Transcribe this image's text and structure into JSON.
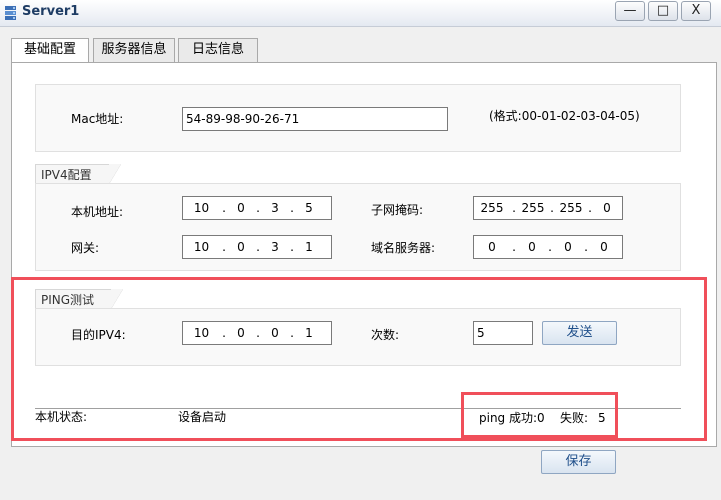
{
  "window": {
    "title": "Server1",
    "minimize_glyph": "—",
    "maximize_glyph": "□",
    "close_glyph": "X"
  },
  "tabs": [
    "基础配置",
    "服务器信息",
    "日志信息"
  ],
  "mac": {
    "label": "Mac地址:",
    "value": "54-89-98-90-26-71",
    "hint": "(格式:00-01-02-03-04-05)"
  },
  "ipv4": {
    "legend": "IPV4配置",
    "ip_label": "本机地址:",
    "ip": [
      "10",
      "0",
      "3",
      "5"
    ],
    "mask_label": "子网掩码:",
    "mask": [
      "255",
      "255",
      "255",
      "0"
    ],
    "gateway_label": "网关:",
    "gateway": [
      "10",
      "0",
      "3",
      "1"
    ],
    "dns_label": "域名服务器:",
    "dns": [
      "0",
      "0",
      "0",
      "0"
    ]
  },
  "ping": {
    "legend": "PING测试",
    "target_label": "目的IPV4:",
    "target": [
      "10",
      "0",
      "0",
      "1"
    ],
    "count_label": "次数:",
    "count": "5",
    "send_label": "发送"
  },
  "status": {
    "label": "本机状态:",
    "value": "设备启动",
    "success_label": "ping 成功:",
    "success_value": "0",
    "fail_label": "失败:",
    "fail_value": "5"
  },
  "save_label": "保存",
  "colors": {
    "highlight": "#f04f5a",
    "title": "#1e3c64",
    "button_text": "#1f4f8a"
  }
}
